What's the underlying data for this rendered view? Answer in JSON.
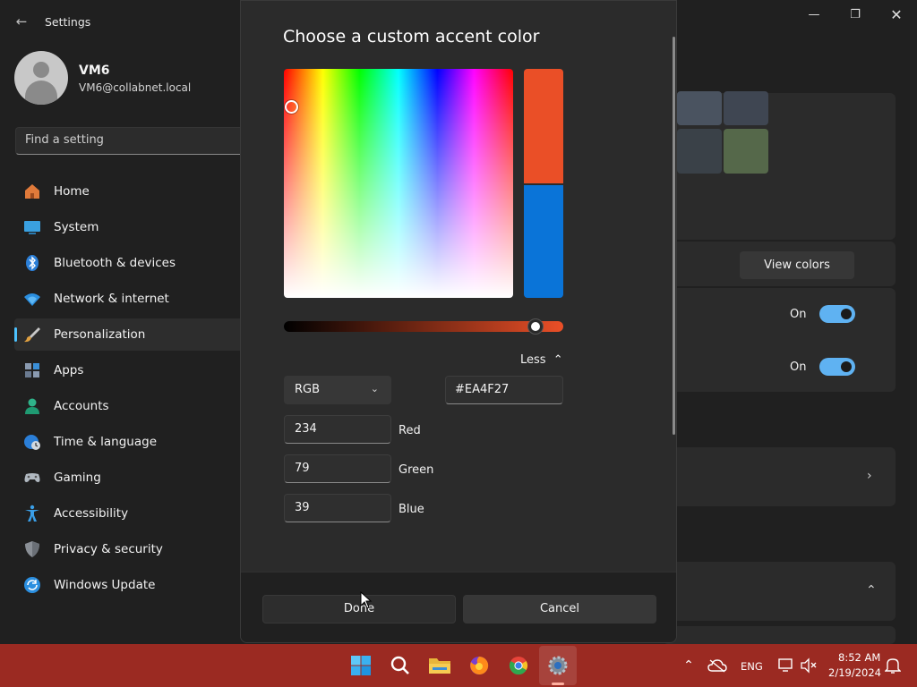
{
  "app": {
    "title": "Settings"
  },
  "user": {
    "name": "VM6",
    "email": "VM6@collabnet.local"
  },
  "search": {
    "placeholder": "Find a setting"
  },
  "nav": {
    "items": [
      {
        "label": "Home",
        "icon": "home-icon"
      },
      {
        "label": "System",
        "icon": "monitor-icon"
      },
      {
        "label": "Bluetooth & devices",
        "icon": "bluetooth-icon"
      },
      {
        "label": "Network & internet",
        "icon": "wifi-icon"
      },
      {
        "label": "Personalization",
        "icon": "brush-icon",
        "selected": true
      },
      {
        "label": "Apps",
        "icon": "apps-icon"
      },
      {
        "label": "Accounts",
        "icon": "person-icon"
      },
      {
        "label": "Time & language",
        "icon": "globe-clock-icon"
      },
      {
        "label": "Gaming",
        "icon": "gamepad-icon"
      },
      {
        "label": "Accessibility",
        "icon": "accessibility-icon"
      },
      {
        "label": "Privacy & security",
        "icon": "shield-icon"
      },
      {
        "label": "Windows Update",
        "icon": "update-icon"
      }
    ]
  },
  "background_panel": {
    "view_colors_label": "View colors",
    "toggles": [
      {
        "label": "On",
        "state": true
      },
      {
        "label": "On",
        "state": true
      }
    ],
    "swatch_colors": [
      "#4a5360",
      "#3f4652",
      "#3a4148",
      "#55684a"
    ]
  },
  "dialog": {
    "title": "Choose a custom accent color",
    "less_label": "Less",
    "mode": "RGB",
    "hex": "#EA4F27",
    "new_color": "#EA4F27",
    "old_color": "#0a74d8",
    "value_level": 0.9,
    "channels": [
      {
        "value": "234",
        "label": "Red"
      },
      {
        "value": "79",
        "label": "Green"
      },
      {
        "value": "39",
        "label": "Blue"
      }
    ],
    "done_label": "Done",
    "cancel_label": "Cancel"
  },
  "taskbar": {
    "apps": [
      "start-icon",
      "search-icon",
      "file-explorer-icon",
      "firefox-icon",
      "chrome-icon",
      "settings-icon"
    ],
    "language": "ENG",
    "time": "8:52 AM",
    "date": "2/19/2024",
    "color": "#9b2a22"
  }
}
